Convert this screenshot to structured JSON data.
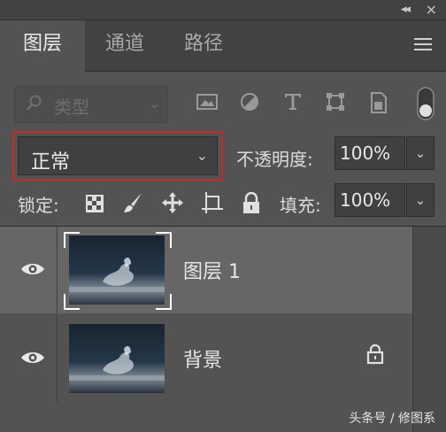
{
  "topbar": {
    "collapse_glyph": "◂◂",
    "close_glyph": "×"
  },
  "tabs": [
    {
      "label": "图层",
      "active": true
    },
    {
      "label": "通道",
      "active": false
    },
    {
      "label": "路径",
      "active": false
    }
  ],
  "filter": {
    "label": "类型",
    "icons": [
      "image-filter-icon",
      "adjustment-filter-icon",
      "type-filter-icon",
      "shape-filter-icon",
      "smart-object-filter-icon",
      "filter-toggle-icon"
    ]
  },
  "blend_mode": {
    "value": "正常"
  },
  "opacity": {
    "label": "不透明度:",
    "value": "100%"
  },
  "lock": {
    "label": "锁定:",
    "icons": [
      "lock-transparent-pixels-icon",
      "lock-image-pixels-icon",
      "lock-position-icon",
      "lock-artboard-icon",
      "lock-all-icon"
    ]
  },
  "fill": {
    "label": "填充:",
    "value": "100%"
  },
  "layers": [
    {
      "name": "图层 1",
      "selected": true,
      "visible": true,
      "locked": false
    },
    {
      "name": "背景",
      "selected": false,
      "visible": true,
      "locked": true
    }
  ],
  "watermark": "头条号 / 修图系"
}
